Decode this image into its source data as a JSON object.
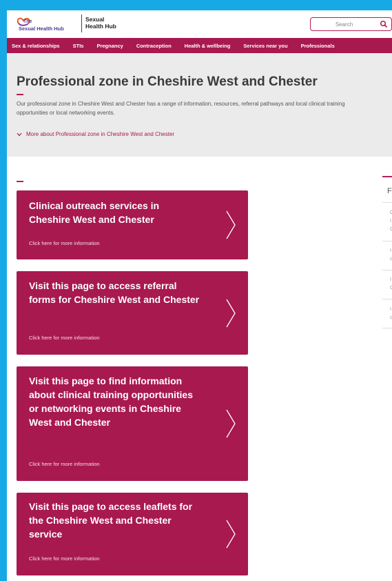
{
  "header": {
    "logo_the": "The",
    "logo_text": "Sexual Health Hub",
    "brand_line1": "Sexual",
    "brand_line2": "Health Hub",
    "search_placeholder": "Search"
  },
  "nav": [
    "Sex & relationships",
    "STIs",
    "Pregnancy",
    "Contraception",
    "Health & wellbeing",
    "Services near you",
    "Professionals"
  ],
  "hero": {
    "title": "Professional zone in Cheshire West and Chester",
    "description": "Our professional zone in Cheshire West and Chester has a range of information, resources, referral pathways and local clinical training opportunities or local networking events.",
    "more_link": "More about Professional zone in Cheshire West and Chester"
  },
  "cards": [
    {
      "title": "Clinical outreach services in Cheshire West and Chester",
      "subtitle": "Click here for more information"
    },
    {
      "title": "Visit this page to access referral forms for Cheshire West and Chester",
      "subtitle": "Click here for more information"
    },
    {
      "title": "Visit this page to find information about clinical training opportunities or networking events in Cheshire West and Chester",
      "subtitle": "Click here for more information"
    },
    {
      "title": "Visit this page to access leaflets for the Cheshire West and Chester service",
      "subtitle": "Click here for more information"
    }
  ],
  "sidebar": {
    "heading_initial": "F",
    "item_initials": [
      "C",
      "I",
      "C",
      "I",
      "c",
      "I",
      "C",
      "I",
      "c"
    ]
  },
  "colors": {
    "brand": "#a8194f",
    "hero_bg": "#ebebeb",
    "frame_bg": "#17a9e6"
  }
}
